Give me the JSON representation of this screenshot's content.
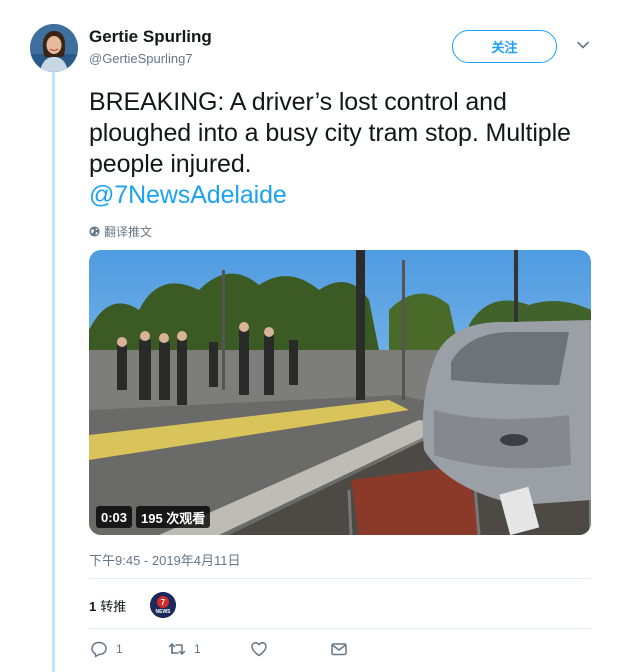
{
  "user": {
    "name": "Gertie Spurling",
    "handle": "@GertieSpurling7"
  },
  "follow_label": "关注",
  "tweet": {
    "text": "BREAKING: A driver’s lost control and ploughed into a busy city tram stop. Multiple people injured.",
    "mention": "@7NewsAdelaide"
  },
  "translate_label": "翻译推文",
  "video": {
    "duration": "0:03",
    "views": "195 次观看"
  },
  "timestamp": "下午9:45 - 2019年4月11日",
  "stats": {
    "retweet_count": "1",
    "retweet_label": "转推"
  },
  "retweeter_avatar": {
    "text": "NEWS",
    "number": "7"
  },
  "actions": {
    "reply_count": "1",
    "retweet_count": "1"
  },
  "colors": {
    "accent": "#1da1f2",
    "secondary_text": "#657786",
    "thread_line": "#c4e4fb"
  },
  "icons": [
    "chevron-down-icon",
    "globe-icon",
    "reply-icon",
    "retweet-icon",
    "heart-icon",
    "envelope-icon"
  ]
}
